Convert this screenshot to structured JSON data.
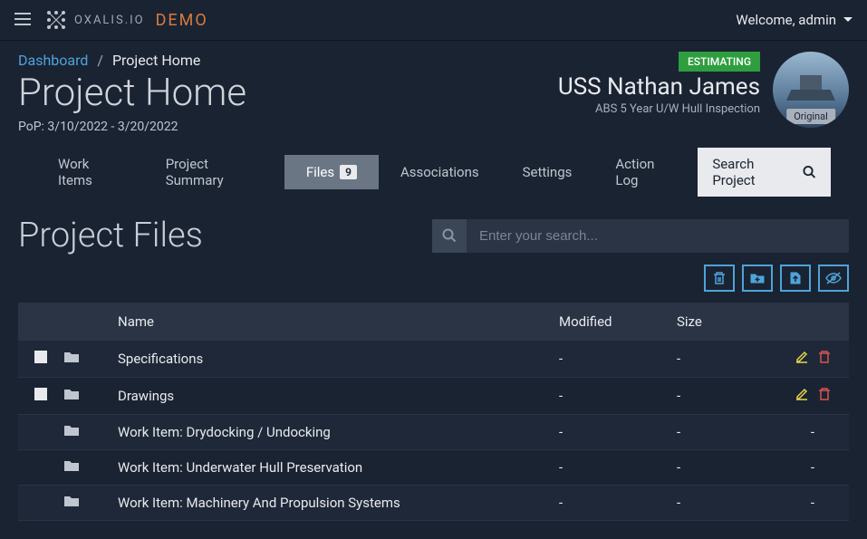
{
  "topbar": {
    "brand": "OXALIS.IO",
    "demo": "DEMO",
    "welcome": "Welcome, admin"
  },
  "breadcrumb": {
    "link": "Dashboard",
    "current": "Project Home"
  },
  "header": {
    "title": "Project Home",
    "pop": "PoP: 3/10/2022 - 3/20/2022"
  },
  "project": {
    "status": "ESTIMATING",
    "name": "USS Nathan James",
    "subtitle": "ABS 5 Year U/W Hull Inspection",
    "avatarLabel": "Original"
  },
  "tabs": [
    {
      "label": "Work Items",
      "active": false
    },
    {
      "label": "Project Summary",
      "active": false
    },
    {
      "label": "Files",
      "count": "9",
      "active": true
    },
    {
      "label": "Associations",
      "active": false
    },
    {
      "label": "Settings",
      "active": false
    },
    {
      "label": "Action Log",
      "active": false
    }
  ],
  "searchProject": "Search Project",
  "section": {
    "title": "Project Files",
    "searchPlaceholder": "Enter your search..."
  },
  "columns": {
    "name": "Name",
    "modified": "Modified",
    "size": "Size"
  },
  "rows": [
    {
      "name": "Specifications",
      "modified": "-",
      "size": "-",
      "checkable": true,
      "editable": true
    },
    {
      "name": "Drawings",
      "modified": "-",
      "size": "-",
      "checkable": true,
      "editable": true
    },
    {
      "name": "Work Item: Drydocking / Undocking",
      "modified": "-",
      "size": "-",
      "checkable": false,
      "editable": false
    },
    {
      "name": "Work Item: Underwater Hull Preservation",
      "modified": "-",
      "size": "-",
      "checkable": false,
      "editable": false
    },
    {
      "name": "Work Item: Machinery And Propulsion Systems",
      "modified": "-",
      "size": "-",
      "checkable": false,
      "editable": false
    }
  ]
}
